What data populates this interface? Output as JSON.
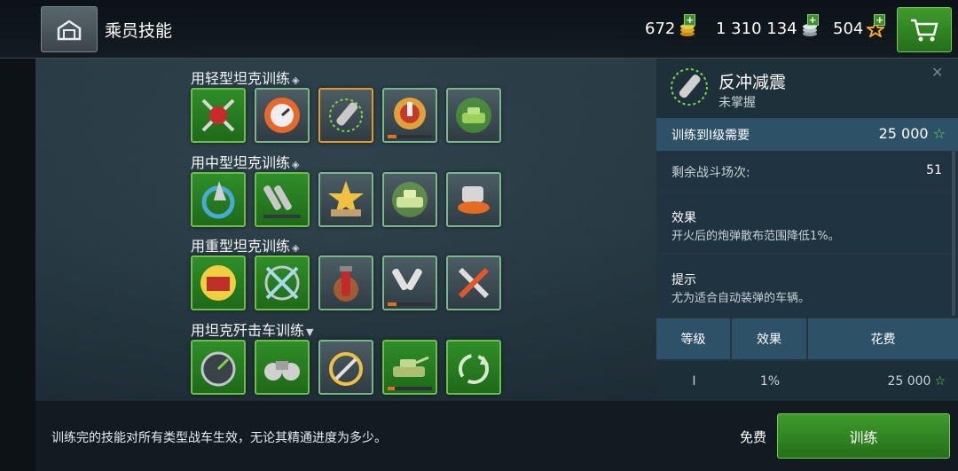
{
  "header": {
    "title": "乘员技能",
    "gold": "672",
    "silver": "1 310 134",
    "xp": "504",
    "plus": "+"
  },
  "categories": [
    {
      "label": "用轻型坦克训练",
      "mark": "◈"
    },
    {
      "label": "用中型坦克训练",
      "mark": "◈"
    },
    {
      "label": "用重型坦克训练",
      "mark": "◈"
    },
    {
      "label": "用坦克歼击车训练",
      "mark": "▼"
    }
  ],
  "skill_progress": {
    "light_4": 0.2,
    "heavy_4": 0.2,
    "td_4": 0.15
  },
  "detail": {
    "close": "✕",
    "name": "反冲减震",
    "status": "未掌握",
    "cost_label": "训练到I级需要",
    "cost_value": "25 000",
    "battles_label": "剩余战斗场次:",
    "battles_value": "51",
    "effect_heading": "效果",
    "effect_text": "开火后的炮弹散布范围降低1%。",
    "tip_heading": "提示",
    "tip_text": "尤为适合自动装弹的车辆。",
    "table_headers": [
      "等级",
      "效果",
      "花费"
    ],
    "table_row": {
      "level": "I",
      "effect": "1%",
      "cost": "25 000"
    }
  },
  "footer": {
    "note": "训练完的技能对所有类型战车生效，无论其精通进度为多少。",
    "free": "免费",
    "train": "训练"
  },
  "colors": {
    "accent_green": "#3f9b2a",
    "progress_orange": "#e0701f",
    "selected_border": "#e59a2a"
  }
}
